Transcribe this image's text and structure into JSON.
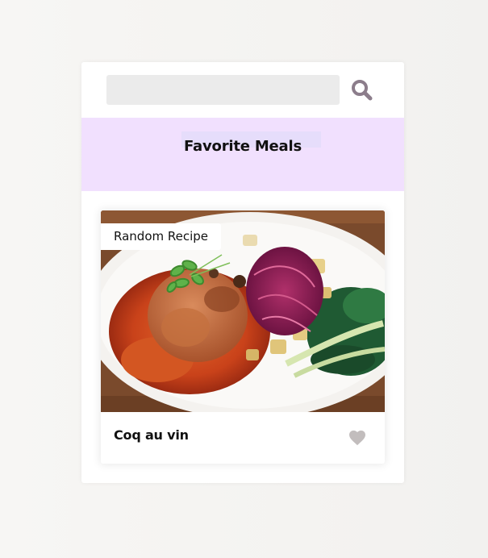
{
  "search": {
    "value": "",
    "placeholder": "",
    "button_icon": "search-icon",
    "icon_color": "#8c7d8b"
  },
  "favorites": {
    "title": "Favorite Meals",
    "background": "#f1e0fe"
  },
  "meal": {
    "tag": "Random Recipe",
    "name": "Coq au vin",
    "like_icon": "heart-icon",
    "like_color": "#c2bdbd"
  }
}
